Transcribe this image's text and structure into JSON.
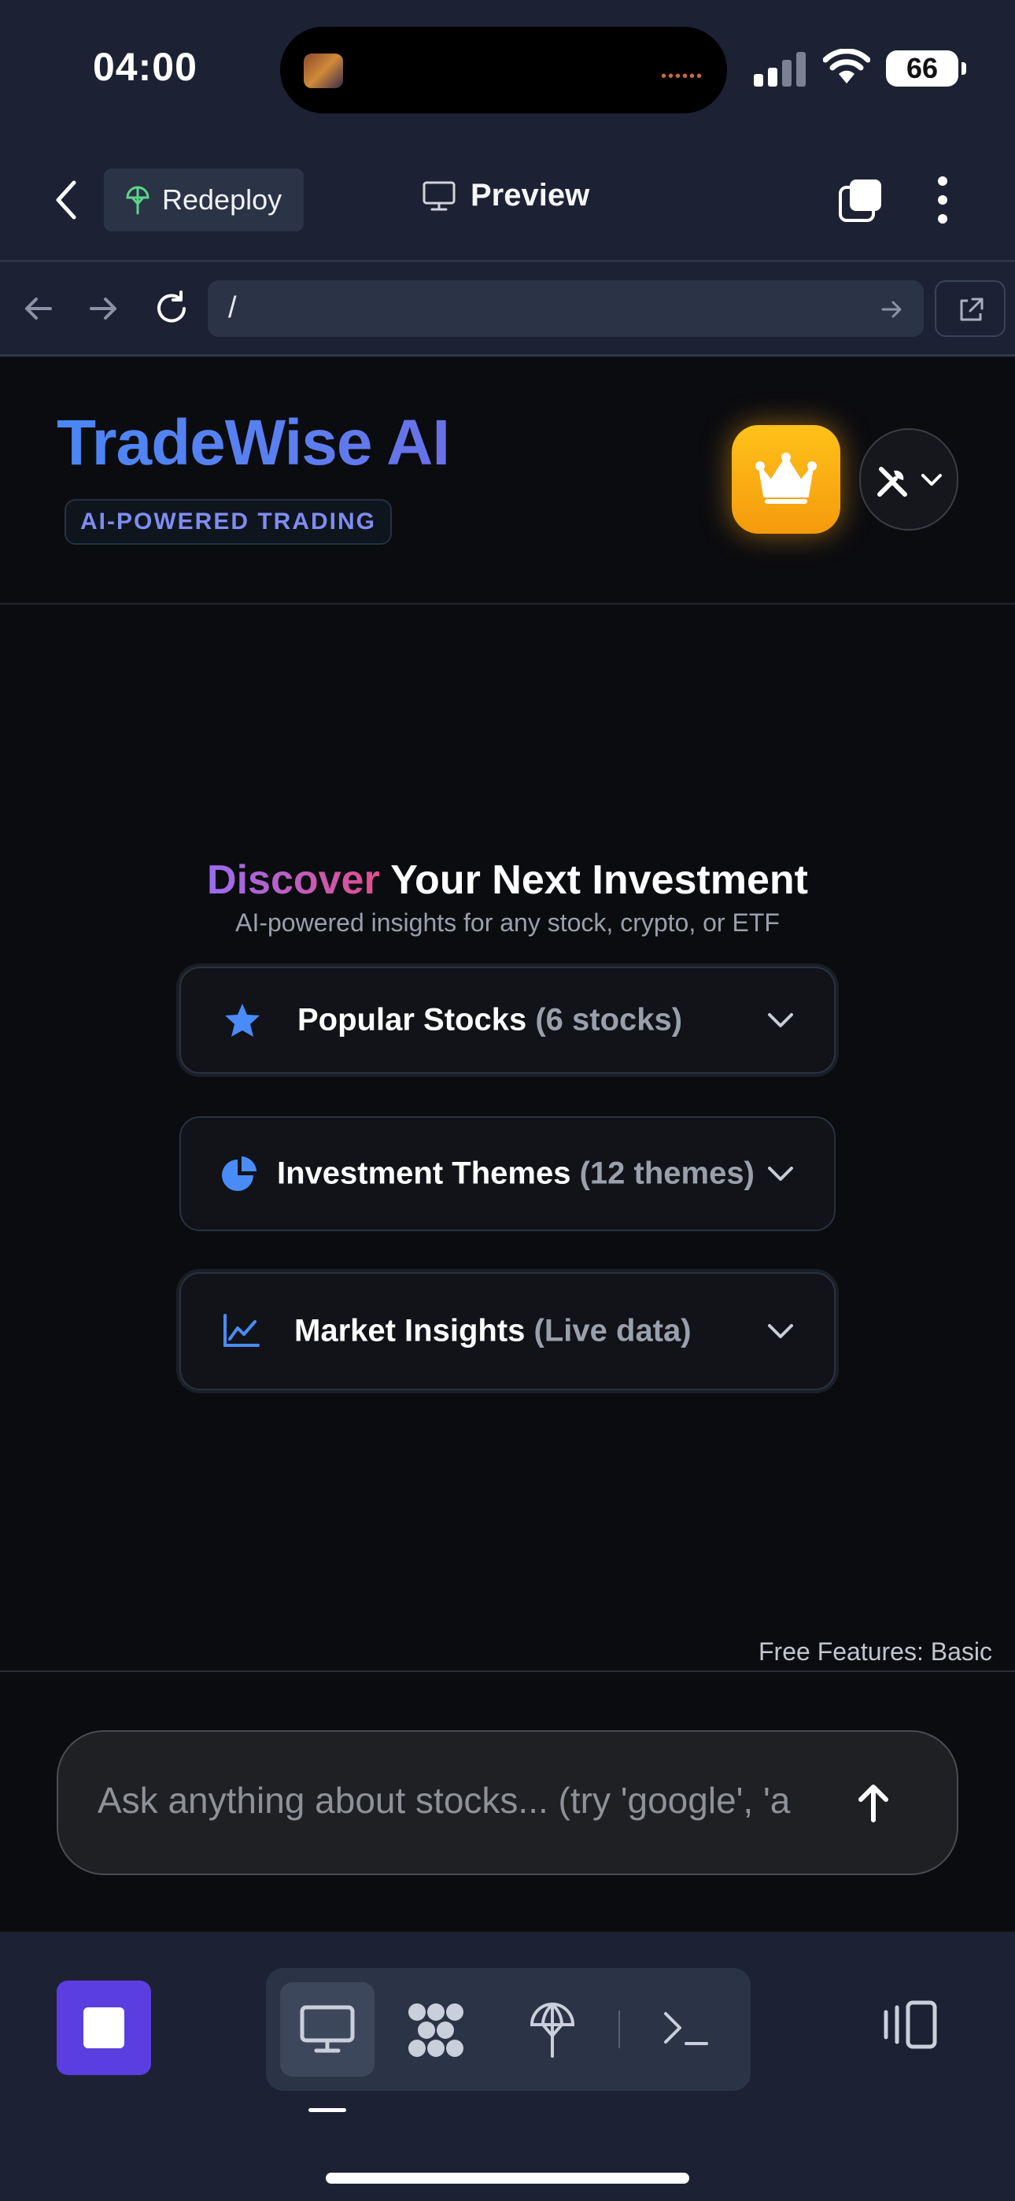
{
  "status_bar": {
    "time": "04:00",
    "battery": "66"
  },
  "replit_header": {
    "redeploy_label": "Redeploy",
    "preview_label": "Preview",
    "url": "/"
  },
  "app_header": {
    "brand": "TradeWise AI",
    "tagline": "AI-POWERED TRADING"
  },
  "hero": {
    "title_accent": "Discover",
    "title_rest": " Your Next Investment",
    "subtitle": "AI-powered insights for any stock, crypto, or ETF"
  },
  "cards": [
    {
      "label": "Popular Stocks",
      "meta": "(6 stocks)",
      "icon": "star-icon"
    },
    {
      "label": "Investment Themes",
      "meta": "(12 themes)",
      "icon": "pie-chart-icon"
    },
    {
      "label": "Market Insights",
      "meta": "(Live data)",
      "icon": "line-chart-icon"
    }
  ],
  "footer_note": "Free Features: Basic",
  "chat": {
    "placeholder": "Ask anything about stocks... (try 'google', 'a"
  },
  "colors": {
    "brand": "#4a86f5",
    "accent_purple": "#9b6cf0",
    "accent_pink": "#e24f8e",
    "crown": "#ffb416",
    "stop": "#5b3ee0"
  }
}
